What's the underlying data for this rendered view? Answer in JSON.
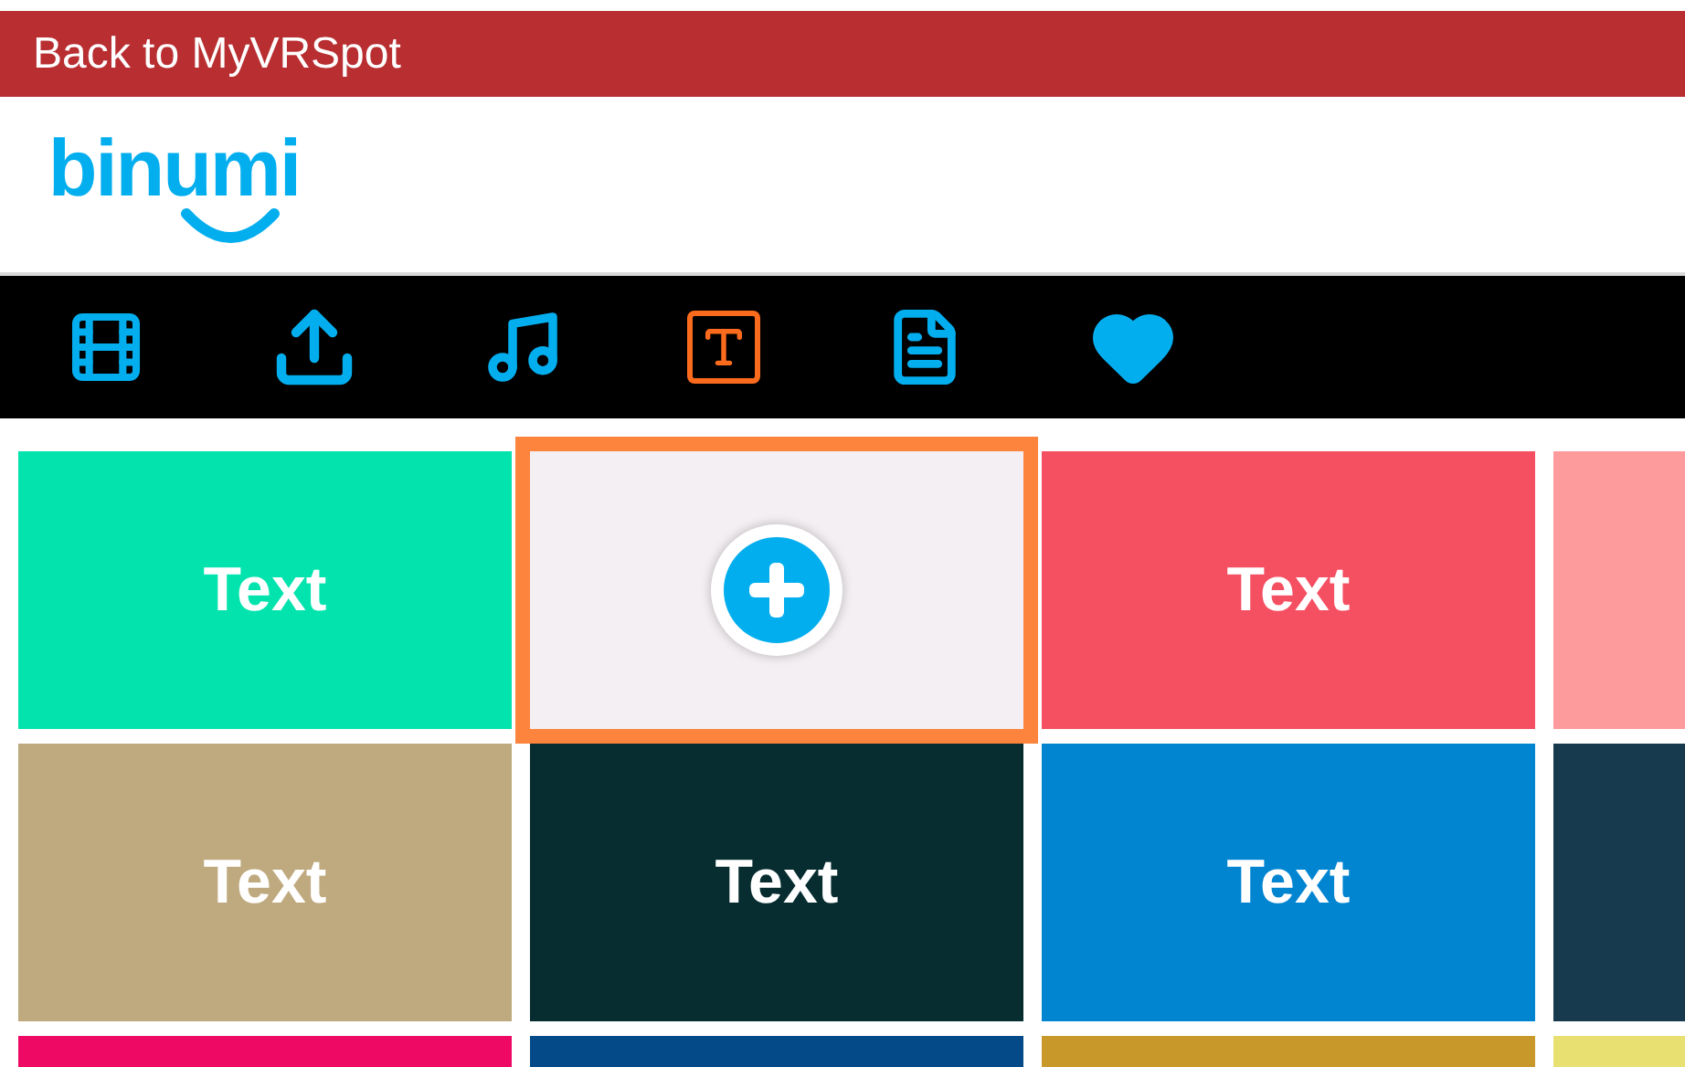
{
  "top_bar": {
    "link": "Back to MyVRSpot"
  },
  "logo": {
    "text": "binumi"
  },
  "toolbar": [
    {
      "kind": "video",
      "selected": false
    },
    {
      "kind": "upload",
      "selected": false
    },
    {
      "kind": "music",
      "selected": false
    },
    {
      "kind": "text",
      "selected": true
    },
    {
      "kind": "document",
      "selected": false
    },
    {
      "kind": "favorite",
      "selected": false
    }
  ],
  "tiles": [
    {
      "kind": "text",
      "label": "Text",
      "color": "#02e3ad",
      "selected": false
    },
    {
      "kind": "add",
      "color": "#f3eff3",
      "selected": true
    },
    {
      "kind": "text",
      "label": "Text",
      "color": "#f54f62",
      "selected": false
    },
    {
      "kind": "blank",
      "color": "#fd9b9c",
      "selected": false
    },
    {
      "kind": "text",
      "label": "Text",
      "color": "#bfa97e",
      "selected": false
    },
    {
      "kind": "text",
      "label": "Text",
      "color": "#072d30",
      "selected": false
    },
    {
      "kind": "text",
      "label": "Text",
      "color": "#0285d1",
      "selected": false
    },
    {
      "kind": "blank",
      "color": "#173a4f",
      "selected": false
    },
    {
      "kind": "blank",
      "color": "#ee0a64",
      "selected": false
    },
    {
      "kind": "blank",
      "color": "#044a88",
      "selected": false
    },
    {
      "kind": "blank",
      "color": "#c8992a",
      "selected": false
    },
    {
      "kind": "blank",
      "color": "#e8e070",
      "selected": false
    }
  ]
}
